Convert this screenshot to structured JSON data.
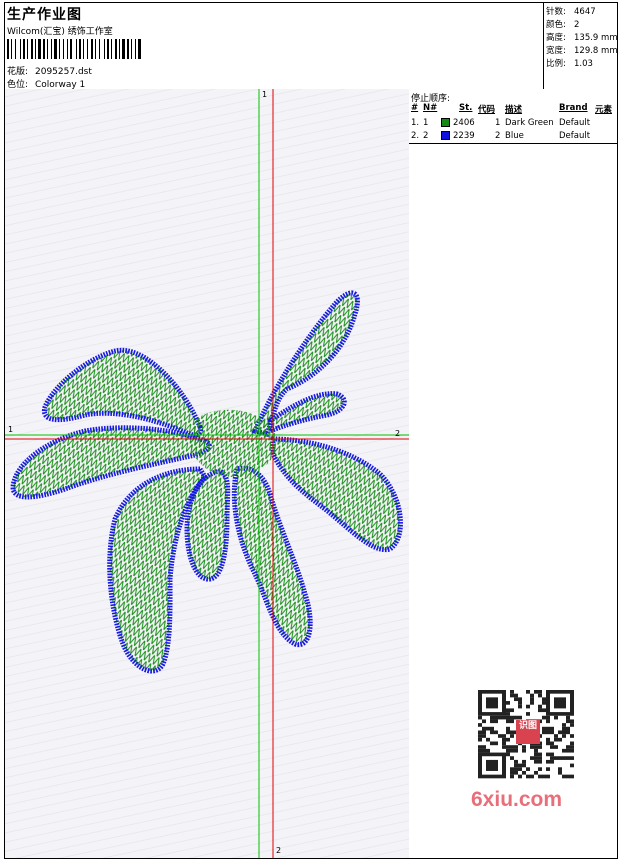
{
  "header": {
    "title": "生产作业图",
    "subtitle": "Wilcom(汇宝) 绣饰工作室",
    "design_label": "花版:",
    "design_file": "2095257.dst",
    "colorway_label": "色位:",
    "colorway": "Colorway 1"
  },
  "stats": [
    {
      "label": "针数:",
      "value": "4647"
    },
    {
      "label": "颜色:",
      "value": "2"
    },
    {
      "label": "高度:",
      "value": "135.9 mm"
    },
    {
      "label": "宽度:",
      "value": "129.8 mm"
    },
    {
      "label": "比例:",
      "value": "1.03"
    }
  ],
  "canvas": {
    "crosshair_x_top": "1",
    "crosshair_x_bottom": "2",
    "crosshair_y_left": "1",
    "crosshair_y_right": "2"
  },
  "stop_sequence": {
    "title": "停止顺序:",
    "columns": [
      "#",
      "N#",
      "St.",
      "代码",
      "描述",
      "Brand",
      "元素"
    ],
    "rows": [
      {
        "num": "1.",
        "n": "1",
        "color": "#118a11",
        "st": "2406",
        "code": "1",
        "desc": "Dark Green",
        "brand": "Default"
      },
      {
        "num": "2.",
        "n": "2",
        "color": "#1010e0",
        "st": "2239",
        "code": "2",
        "desc": "Blue",
        "brand": "Default"
      }
    ]
  },
  "colors": {
    "green": "#1a8f1a",
    "blue": "#1818e6",
    "crosshair_red": "#e00000",
    "crosshair_green": "#00c000",
    "brand": "#e86f7a"
  },
  "watermark": {
    "seal_text": "识图",
    "brand_text": "6xiu.com"
  }
}
